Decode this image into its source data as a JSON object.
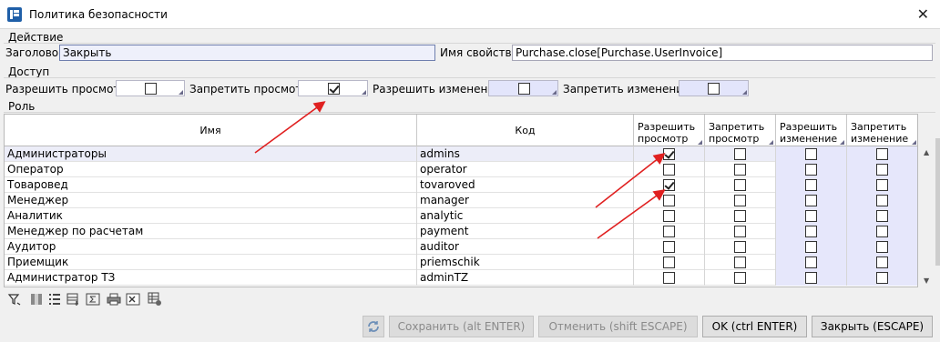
{
  "window": {
    "title": "Политика безопасности"
  },
  "action": {
    "section": "Действие",
    "header_label": "Заголовок",
    "header_value": "Закрыть",
    "property_label": "Имя свойства",
    "property_value": "Purchase.close[Purchase.UserInvoice]"
  },
  "access": {
    "section": "Доступ",
    "allow_view_label": "Разрешить просмотр",
    "allow_view": false,
    "deny_view_label": "Запретить просмотр",
    "deny_view": true,
    "allow_edit_label": "Разрешить изменение",
    "allow_edit": false,
    "deny_edit_label": "Запретить изменение",
    "deny_edit": false
  },
  "role": {
    "section": "Роль",
    "columns": {
      "name": "Имя",
      "code": "Код",
      "allow_view_1": "Разрешить",
      "allow_view_2": "просмотр",
      "deny_view_1": "Запретить",
      "deny_view_2": "просмотр",
      "allow_edit_1": "Разрешить",
      "allow_edit_2": "изменение",
      "deny_edit_1": "Запретить",
      "deny_edit_2": "изменение"
    },
    "rows": [
      {
        "name": "Администраторы",
        "code": "admins",
        "allow_view": true,
        "deny_view": false,
        "allow_edit": false,
        "deny_edit": false
      },
      {
        "name": "Оператор",
        "code": "operator",
        "allow_view": false,
        "deny_view": false,
        "allow_edit": false,
        "deny_edit": false
      },
      {
        "name": "Товаровед",
        "code": "tovaroved",
        "allow_view": true,
        "deny_view": false,
        "allow_edit": false,
        "deny_edit": false
      },
      {
        "name": "Менеджер",
        "code": "manager",
        "allow_view": false,
        "deny_view": false,
        "allow_edit": false,
        "deny_edit": false
      },
      {
        "name": "Аналитик",
        "code": "analytic",
        "allow_view": false,
        "deny_view": false,
        "allow_edit": false,
        "deny_edit": false
      },
      {
        "name": "Менеджер по расчетам",
        "code": "payment",
        "allow_view": false,
        "deny_view": false,
        "allow_edit": false,
        "deny_edit": false
      },
      {
        "name": "Аудитор",
        "code": "auditor",
        "allow_view": false,
        "deny_view": false,
        "allow_edit": false,
        "deny_edit": false
      },
      {
        "name": "Приемщик",
        "code": "priemschik",
        "allow_view": false,
        "deny_view": false,
        "allow_edit": false,
        "deny_edit": false
      },
      {
        "name": "Администратор ТЗ",
        "code": "adminTZ",
        "allow_view": false,
        "deny_view": false,
        "allow_edit": false,
        "deny_edit": false
      }
    ]
  },
  "toolbar_icons": [
    "filter-icon",
    "column-icon",
    "list-icon",
    "add-row-icon",
    "sum-icon",
    "print-icon",
    "excel-icon",
    "grid-settings-icon"
  ],
  "buttons": {
    "save": "Сохранить (alt ENTER)",
    "cancel": "Отменить (shift ESCAPE)",
    "ok": "OK (ctrl ENTER)",
    "close": "Закрыть (ESCAPE)"
  },
  "colors": {
    "tint": "#e6e7fb",
    "arrow": "#e02020"
  }
}
